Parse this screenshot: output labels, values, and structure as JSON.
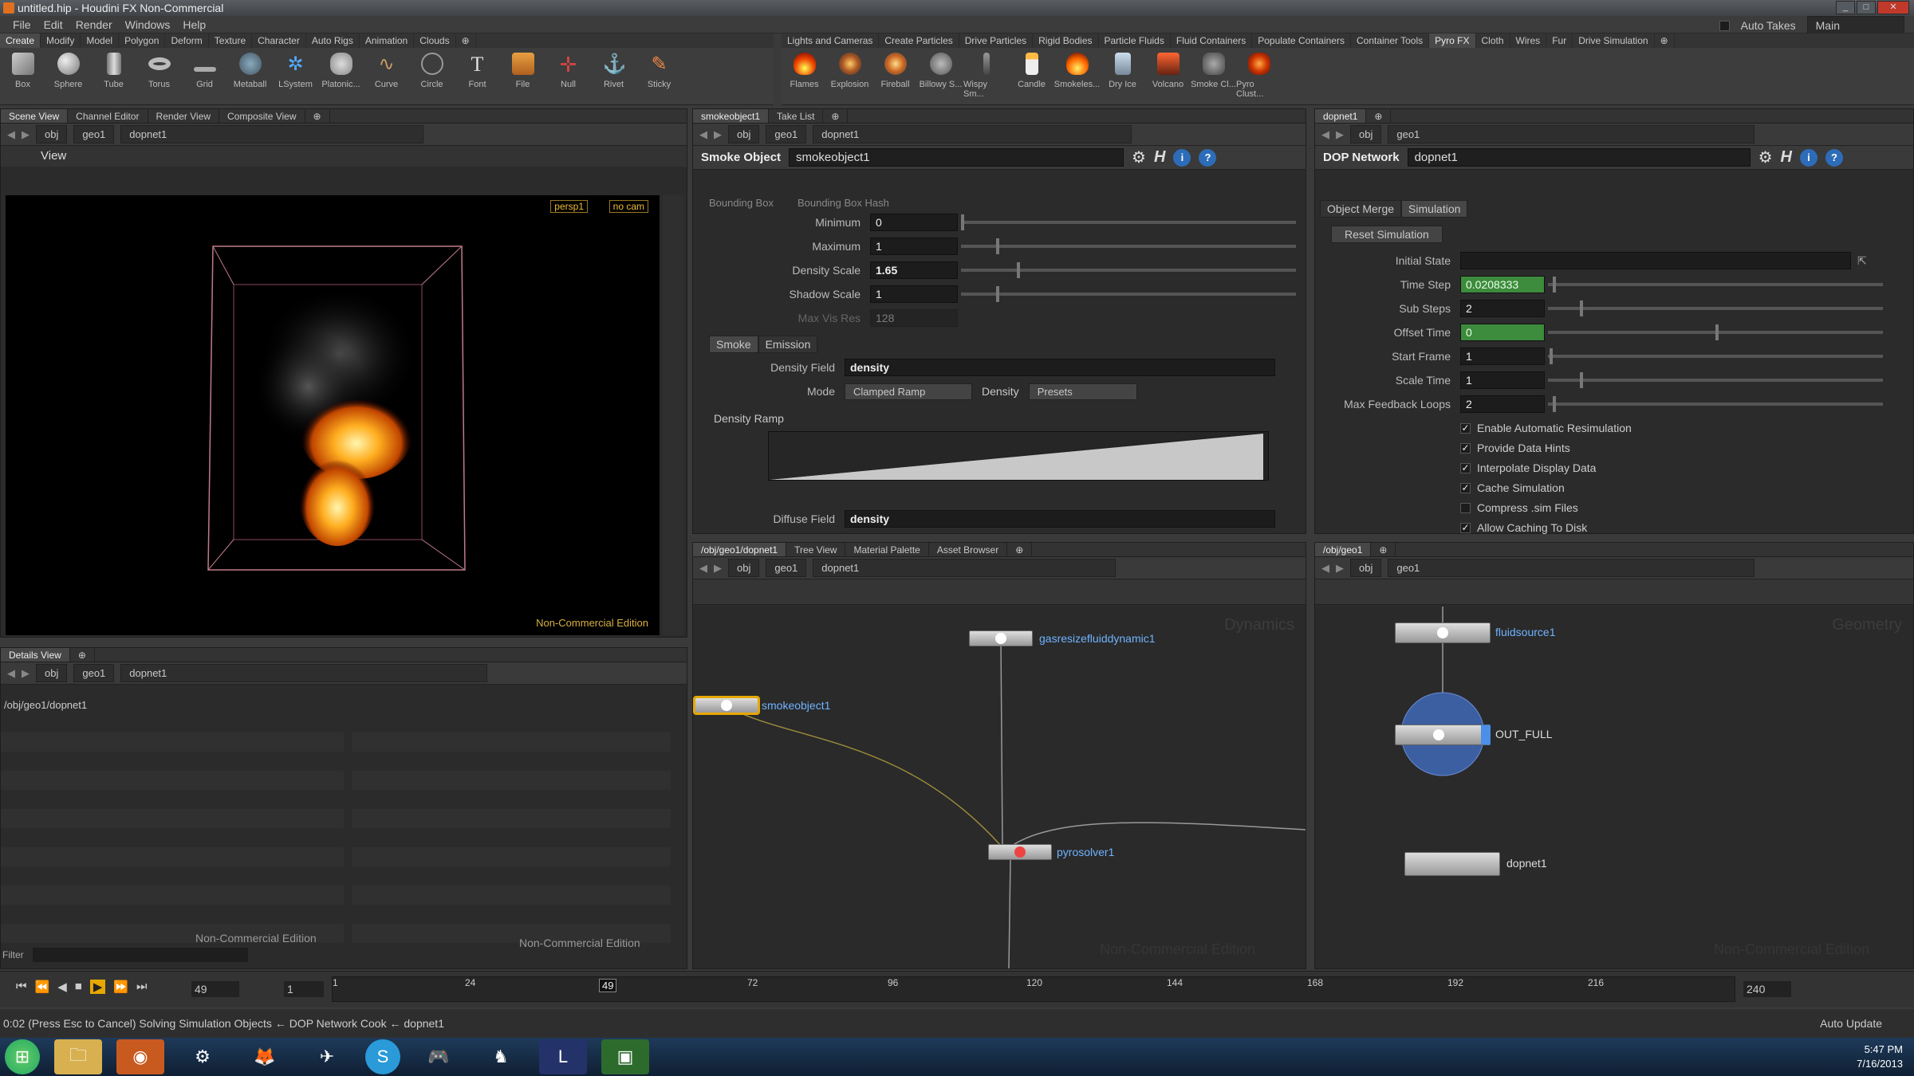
{
  "window": {
    "title": "untitled.hip - Houdini FX Non-Commercial"
  },
  "menu": {
    "items": [
      "File",
      "Edit",
      "Render",
      "Windows",
      "Help"
    ],
    "auto_takes": "Auto Takes",
    "desktop": "Main"
  },
  "shelf_left": {
    "tabs": [
      "Create",
      "Modify",
      "Model",
      "Polygon",
      "Deform",
      "Texture",
      "Character",
      "Auto Rigs",
      "Animation",
      "Clouds"
    ],
    "tools": [
      "Box",
      "Sphere",
      "Tube",
      "Torus",
      "Grid",
      "Metaball",
      "LSystem",
      "Platonic...",
      "Curve",
      "Circle",
      "Font",
      "File",
      "Null",
      "Rivet",
      "Sticky"
    ]
  },
  "shelf_right": {
    "tabs": [
      "Lights and Cameras",
      "Create Particles",
      "Drive Particles",
      "Rigid Bodies",
      "Particle Fluids",
      "Fluid Containers",
      "Populate Containers",
      "Container Tools",
      "Pyro FX",
      "Cloth",
      "Wires",
      "Fur",
      "Drive Simulation"
    ],
    "tools": [
      "Flames",
      "Explosion",
      "Fireball",
      "Billowy S...",
      "Wispy Sm...",
      "Candle",
      "Smokeles...",
      "Dry Ice",
      "Volcano",
      "Smoke Cl...",
      "Pyro Clust..."
    ]
  },
  "scene_view": {
    "tabs": [
      "Scene View",
      "Channel Editor",
      "Render View",
      "Composite View"
    ],
    "path": [
      "obj",
      "geo1",
      "dopnet1"
    ],
    "title": "View",
    "camera_persp": "persp1",
    "camera_cam": "no cam",
    "watermark": "Non-Commercial Edition"
  },
  "details_view": {
    "tab": "Details View",
    "path": [
      "obj",
      "geo1",
      "dopnet1"
    ],
    "tree_item": "/obj/geo1/dopnet1",
    "watermark_left": "Non-Commercial Edition",
    "watermark_right": "Non-Commercial Edition",
    "filter_label": "Filter"
  },
  "smoke_params": {
    "tabs": [
      "smokeobject1",
      "Take List"
    ],
    "path": [
      "obj",
      "geo1",
      "dopnet1"
    ],
    "type_label": "Smoke Object",
    "name": "smokeobject1",
    "bounding_box": "Bounding Box",
    "bounding_box_hash": "Bounding Box Hash",
    "minimum_label": "Minimum",
    "minimum": "0",
    "maximum_label": "Maximum",
    "maximum": "1",
    "density_scale_label": "Density Scale",
    "density_scale": "1.65",
    "shadow_scale_label": "Shadow Scale",
    "shadow_scale": "1",
    "max_vis_res_label": "Max Vis Res",
    "max_vis_res": "128",
    "subtabs": [
      "Smoke",
      "Emission"
    ],
    "density_field_label": "Density Field",
    "density_field": "density",
    "mode_label": "Mode",
    "mode": "Clamped Ramp",
    "density_label": "Density",
    "presets": "Presets",
    "density_ramp_label": "Density Ramp",
    "diffuse_field_label": "Diffuse Field",
    "diffuse_field": "density"
  },
  "dop_params": {
    "tab": "dopnet1",
    "path": [
      "obj",
      "geo1"
    ],
    "type_label": "DOP Network",
    "name": "dopnet1",
    "subtabs": [
      "Object Merge",
      "Simulation"
    ],
    "reset_button": "Reset Simulation",
    "initial_state_label": "Initial State",
    "time_step_label": "Time Step",
    "time_step": "0.0208333",
    "sub_steps_label": "Sub Steps",
    "sub_steps": "2",
    "offset_time_label": "Offset Time",
    "offset_time": "0",
    "start_frame_label": "Start Frame",
    "start_frame": "1",
    "scale_time_label": "Scale Time",
    "scale_time": "1",
    "max_feedback_label": "Max Feedback Loops",
    "max_feedback": "2",
    "checkboxes": [
      "Enable Automatic Resimulation",
      "Provide Data Hints",
      "Interpolate Display Data",
      "Cache Simulation",
      "Compress .sim Files",
      "Allow Caching To Disk"
    ]
  },
  "dop_network": {
    "tabs": [
      "/obj/geo1/dopnet1",
      "Tree View",
      "Material Palette",
      "Asset Browser"
    ],
    "path": [
      "obj",
      "geo1",
      "dopnet1"
    ],
    "context_label": "Dynamics",
    "nodes": [
      "gasresizefluiddynamic1",
      "smokeobject1",
      "pyrosolver1"
    ],
    "watermark": "Non-Commercial Edition"
  },
  "geo_network": {
    "tab": "/obj/geo1",
    "path": [
      "obj",
      "geo1"
    ],
    "context_label": "Geometry",
    "nodes": [
      "fluidsource1",
      "OUT_FULL",
      "dopnet1"
    ],
    "watermark": "Non-Commercial Edition"
  },
  "timeline": {
    "current_frame": "49",
    "start_frame": "1",
    "end_frame": "240",
    "ticks": [
      "1",
      "24",
      "49",
      "72",
      "96",
      "120",
      "144",
      "168",
      "192",
      "216"
    ],
    "auto_update": "Auto Update"
  },
  "status": {
    "text": "0:02 (Press Esc to Cancel) Solving Simulation Objects ← DOP Network Cook ← dopnet1"
  },
  "taskbar": {
    "time": "5:47 PM",
    "date": "7/16/2013"
  }
}
